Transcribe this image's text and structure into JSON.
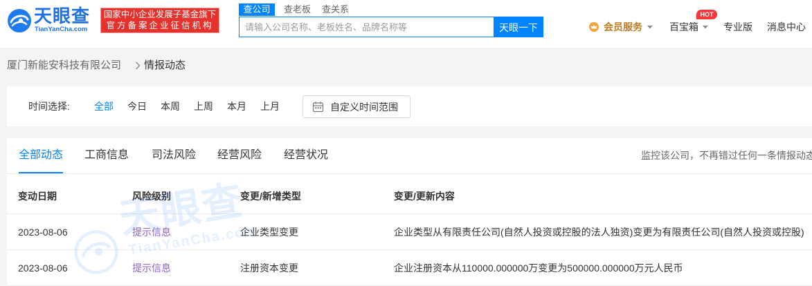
{
  "header": {
    "logo": {
      "title": "天眼查",
      "domain": "TianYanCha.com"
    },
    "badge": {
      "line1": "国家中小企业发展子基金旗下",
      "line2": "官方备案企业征信机构"
    },
    "search": {
      "tabs": [
        "查公司",
        "查老板",
        "查关系"
      ],
      "active_tab": "查公司",
      "placeholder": "请输入公司名称、老板姓名、品牌名称等",
      "button": "天眼一下"
    },
    "nav": {
      "vip": "会员服务",
      "toolbox": "百宝箱",
      "toolbox_badge": "HOT",
      "pro": "专业版",
      "messages": "消息中心"
    }
  },
  "breadcrumb": {
    "company": "厦门新能安科技有限公司",
    "current": "情报动态"
  },
  "time_filter": {
    "label": "时间选择:",
    "options": [
      "全部",
      "今日",
      "本周",
      "上周",
      "本月",
      "上月"
    ],
    "selected": "全部",
    "custom_range": "自定义时间范围"
  },
  "dynamics": {
    "tabs": [
      "全部动态",
      "工商信息",
      "司法风险",
      "经营风险",
      "经营状况"
    ],
    "active_tab": "全部动态",
    "monitor_tip": "监控该公司，不再错过任何一条情报动态",
    "columns": {
      "date": "变动日期",
      "risk": "风险级别",
      "type": "变更/新增类型",
      "content": "变更/更新内容"
    },
    "rows": [
      {
        "date": "2023-08-06",
        "risk": "提示信息",
        "type": "企业类型变更",
        "content": "企业类型从有限责任公司(自然人投资或控股的法人独资)变更为有限责任公司(自然人投资或控股)"
      },
      {
        "date": "2023-08-06",
        "risk": "提示信息",
        "type": "注册资本变更",
        "content": "企业注册资本从110000.000000万变更为500000.000000万元人民币"
      }
    ]
  },
  "watermark": {
    "title": "天眼查",
    "domain": "TianYanCha.com"
  },
  "icons": {
    "logo": "tianyancha-logo-icon",
    "vip": "crown-icon",
    "dropdown": "chevron-down-icon",
    "breadcrumb_separator": "chevron-right-icon",
    "custom_range": "calendar-icon"
  },
  "colors": {
    "brand": "#0084ff",
    "badge": "#e5322d",
    "vip": "#c07a1e",
    "hot": "#f5393a",
    "risk_info": "#8e5fd3",
    "page_bg": "#f3f4f6"
  }
}
